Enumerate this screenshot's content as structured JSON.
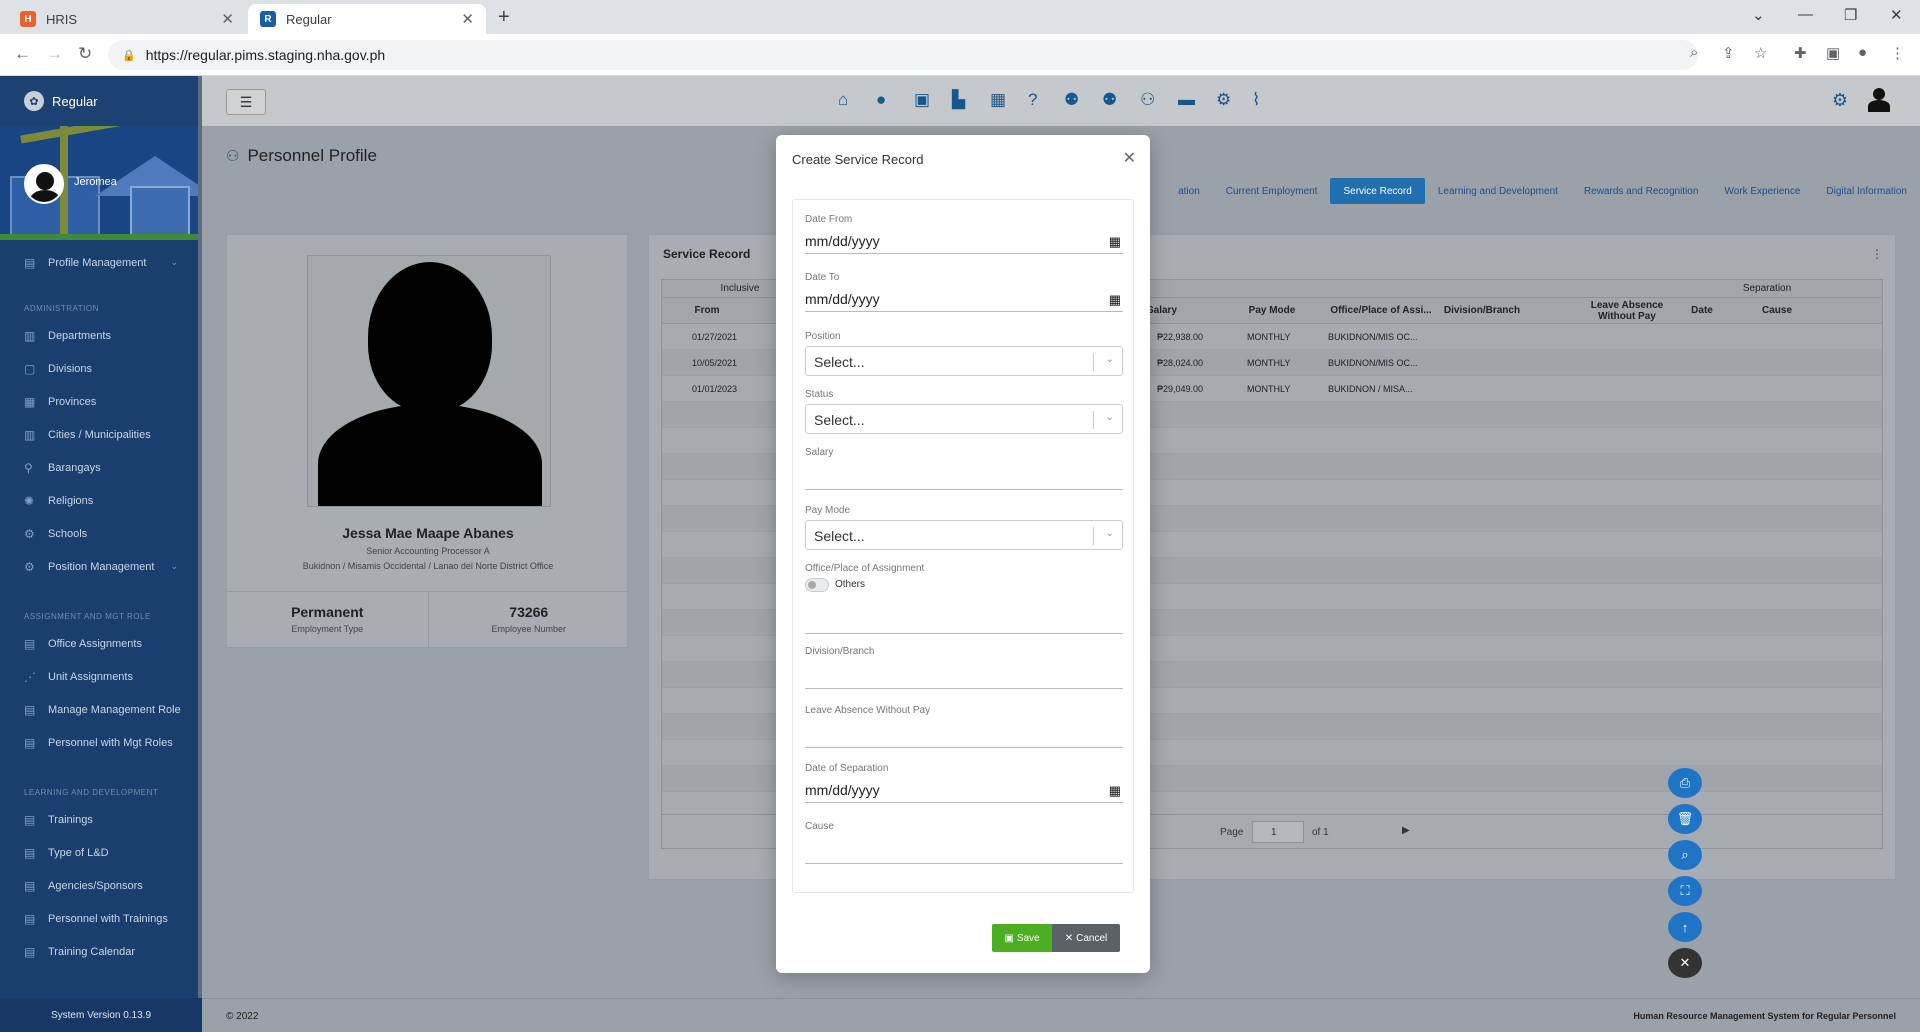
{
  "browser": {
    "tabs": [
      {
        "label": "HRIS",
        "favicon": "H"
      },
      {
        "label": "Regular",
        "favicon": "R"
      }
    ],
    "url": "https://regular.pims.staging.nha.gov.ph"
  },
  "sidebar": {
    "brand": "Regular",
    "user": "Jeromea",
    "profile_management": "Profile Management",
    "sections": [
      {
        "heading": "ADMINISTRATION",
        "items": [
          "Departments",
          "Divisions",
          "Provinces",
          "Cities / Municipalities",
          "Barangays",
          "Religions",
          "Schools",
          "Position Management"
        ]
      },
      {
        "heading": "ASSIGNMENT AND MGT ROLE",
        "items": [
          "Office Assignments",
          "Unit Assignments",
          "Manage Management Role",
          "Personnel with Mgt Roles"
        ]
      },
      {
        "heading": "LEARNING AND DEVELOPMENT",
        "items": [
          "Trainings",
          "Type of L&D",
          "Agencies/Sponsors",
          "Personnel with Trainings",
          "Training Calendar"
        ]
      }
    ],
    "version": "System Version 0.13.9"
  },
  "page": {
    "title": "Personnel Profile",
    "tabs": [
      {
        "label": "ation",
        "active": false
      },
      {
        "label": "Current Employment",
        "active": false
      },
      {
        "label": "Service Record",
        "active": true
      },
      {
        "label": "Learning and Development",
        "active": false
      },
      {
        "label": "Rewards and Recognition",
        "active": false
      },
      {
        "label": "Work Experience",
        "active": false
      },
      {
        "label": "Digital Information",
        "active": false
      }
    ]
  },
  "profile": {
    "name": "Jessa Mae Maape Abanes",
    "position": "Senior Accounting Processor A",
    "office": "Bukidnon / Misamis Occidental / Lanao del Norte District Office",
    "employment_type": "Permanent",
    "employment_type_label": "Employment Type",
    "employee_number": "73266",
    "employee_number_label": "Employee Number"
  },
  "service_record": {
    "title": "Service Record",
    "group_headers": {
      "inclusive": "Inclusive",
      "separation": "Separation"
    },
    "columns": [
      "From",
      "Salary",
      "Pay Mode",
      "Office/Place of Assi...",
      "Division/Branch",
      "Leave Absence Without Pay",
      "Date",
      "Cause"
    ],
    "rows": [
      {
        "from": "01/27/2021",
        "salary": "₱22,938.00",
        "pay_mode": "MONTHLY",
        "office": "BUKIDNON/MIS OC..."
      },
      {
        "from": "10/05/2021",
        "salary": "₱28,024.00",
        "pay_mode": "MONTHLY",
        "office": "BUKIDNON/MIS OC..."
      },
      {
        "from": "01/01/2023",
        "salary": "₱29,049.00",
        "pay_mode": "MONTHLY",
        "office": "BUKIDNON / MISA..."
      }
    ],
    "pager": {
      "page_label": "Page",
      "page": "1",
      "of_label": "of 1"
    }
  },
  "modal": {
    "title": "Create Service Record",
    "fields": {
      "date_from": {
        "label": "Date From",
        "value": "mm/dd/yyyy"
      },
      "date_to": {
        "label": "Date To",
        "value": "mm/dd/yyyy"
      },
      "position": {
        "label": "Position",
        "value": "Select..."
      },
      "status": {
        "label": "Status",
        "value": "Select..."
      },
      "salary": {
        "label": "Salary",
        "value": ""
      },
      "pay_mode": {
        "label": "Pay Mode",
        "value": "Select..."
      },
      "office": {
        "label": "Office/Place of Assignment",
        "toggle_label": "Others"
      },
      "division": {
        "label": "Division/Branch",
        "value": ""
      },
      "lwop": {
        "label": "Leave Absence Without Pay",
        "value": ""
      },
      "date_separation": {
        "label": "Date of Separation",
        "value": "mm/dd/yyyy"
      },
      "cause": {
        "label": "Cause",
        "value": ""
      }
    },
    "save_label": "Save",
    "cancel_label": "Cancel"
  },
  "footer": {
    "copyright": "© 2022",
    "system_name": "Human Resource Management System for Regular Personnel"
  },
  "colors": {
    "primary": "#1f6fb3",
    "sidebar": "#1a3e6e",
    "save": "#4cae22",
    "cancel": "#5a6268"
  }
}
